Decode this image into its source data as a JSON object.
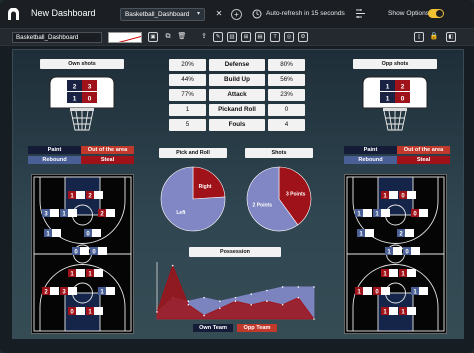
{
  "app": {
    "title": "New Dashboard"
  },
  "titlebar": {
    "dashboard_select": "Basketball_Dashboard",
    "autorefresh": "Auto-refresh in 15 seconds",
    "show_options": "Show Options"
  },
  "toolbar": {
    "dashboard_name": "Basketball_Dashboard"
  },
  "colors": {
    "own": "#1a2244",
    "opp": "#a01219",
    "paint_fill": "#15254a",
    "pie_blue": "#8087c4",
    "pie_red": "#a01219"
  },
  "own_side": {
    "title": "Own shots",
    "hoop_top": [
      "2",
      "3"
    ],
    "hoop_bottom": [
      "1",
      "0"
    ],
    "zones": [
      {
        "label": "Paint",
        "tone": "own"
      },
      {
        "label": "Out of the area",
        "tone": "opp"
      },
      {
        "label": "Rebound",
        "tone": "steel"
      },
      {
        "label": "Steal",
        "tone": "opp"
      }
    ],
    "court_markers": [
      [
        {
          "v": "1",
          "t": "r"
        },
        {
          "v": "2",
          "t": "r"
        }
      ],
      [
        {
          "v": "3",
          "t": "b"
        },
        {
          "v": "1",
          "t": "b"
        },
        {
          "v": "2",
          "t": "r"
        }
      ],
      [
        {
          "v": "1",
          "t": "b"
        },
        {
          "v": "0",
          "t": "b"
        }
      ],
      [
        {
          "v": "0",
          "t": "b"
        },
        {
          "v": "0",
          "t": "b"
        }
      ],
      [
        {
          "v": "1",
          "t": "r"
        },
        {
          "v": "1",
          "t": "r"
        }
      ],
      [
        {
          "v": "2",
          "t": "r"
        },
        {
          "v": "3",
          "t": "r"
        },
        {
          "v": "1",
          "t": "b"
        }
      ],
      [
        {
          "v": "0",
          "t": "r"
        },
        {
          "v": "1",
          "t": "r"
        }
      ]
    ]
  },
  "opp_side": {
    "title": "Opp shots",
    "hoop_top": [
      "1",
      "2"
    ],
    "hoop_bottom": [
      "1",
      "0"
    ],
    "zones": [
      {
        "label": "Paint",
        "tone": "own"
      },
      {
        "label": "Out of the area",
        "tone": "opp"
      },
      {
        "label": "Rebound",
        "tone": "steel"
      },
      {
        "label": "Steal",
        "tone": "opp"
      }
    ],
    "court_markers": [
      [
        {
          "v": "1",
          "t": "r"
        },
        {
          "v": "0",
          "t": "r"
        }
      ],
      [
        {
          "v": "1",
          "t": "b"
        },
        {
          "v": "1",
          "t": "b"
        },
        {
          "v": "0",
          "t": "r"
        }
      ],
      [
        {
          "v": "1",
          "t": "b"
        },
        {
          "v": "2",
          "t": "b"
        }
      ],
      [
        {
          "v": "1",
          "t": "b"
        },
        {
          "v": "0",
          "t": "b"
        }
      ],
      [
        {
          "v": "1",
          "t": "r"
        },
        {
          "v": "1",
          "t": "r"
        }
      ],
      [
        {
          "v": "1",
          "t": "r"
        },
        {
          "v": "0",
          "t": "r"
        },
        {
          "v": "1",
          "t": "b"
        }
      ],
      [
        {
          "v": "1",
          "t": "r"
        },
        {
          "v": "1",
          "t": "r"
        }
      ]
    ]
  },
  "stats": [
    {
      "own": "20%",
      "label": "Defense",
      "opp": "80%"
    },
    {
      "own": "44%",
      "label": "Build Up",
      "opp": "56%"
    },
    {
      "own": "77%",
      "label": "Attack",
      "opp": "23%"
    },
    {
      "own": "1",
      "label": "Pickand Roll",
      "opp": "0"
    },
    {
      "own": "5",
      "label": "Fouls",
      "opp": "4"
    }
  ],
  "chart_data": [
    {
      "type": "pie",
      "title": "Pick and Roll",
      "slices": [
        {
          "label": "Right",
          "value": 24,
          "color": "#a01219"
        },
        {
          "label": "Left",
          "value": 76,
          "color": "#8087c4"
        }
      ]
    },
    {
      "type": "pie",
      "title": "Shots",
      "slices": [
        {
          "label": "3 Points",
          "value": 40,
          "color": "#a01219"
        },
        {
          "label": "2 Points",
          "value": 60,
          "color": "#8087c4"
        }
      ]
    },
    {
      "type": "area",
      "title": "Possession",
      "x": [
        0,
        1,
        2,
        3,
        4,
        5,
        6,
        7,
        8,
        9,
        10
      ],
      "series": [
        {
          "name": "Own Team",
          "values": [
            2,
            6,
            5,
            6,
            5,
            6,
            7,
            8,
            9,
            9,
            9
          ],
          "color": "#8087c4"
        },
        {
          "name": "Opp Team",
          "values": [
            2,
            15,
            4,
            1,
            3,
            5,
            4,
            5,
            4,
            6,
            0
          ],
          "color": "#a01219"
        }
      ],
      "legend": [
        "Own Team",
        "Opp Team"
      ]
    }
  ]
}
